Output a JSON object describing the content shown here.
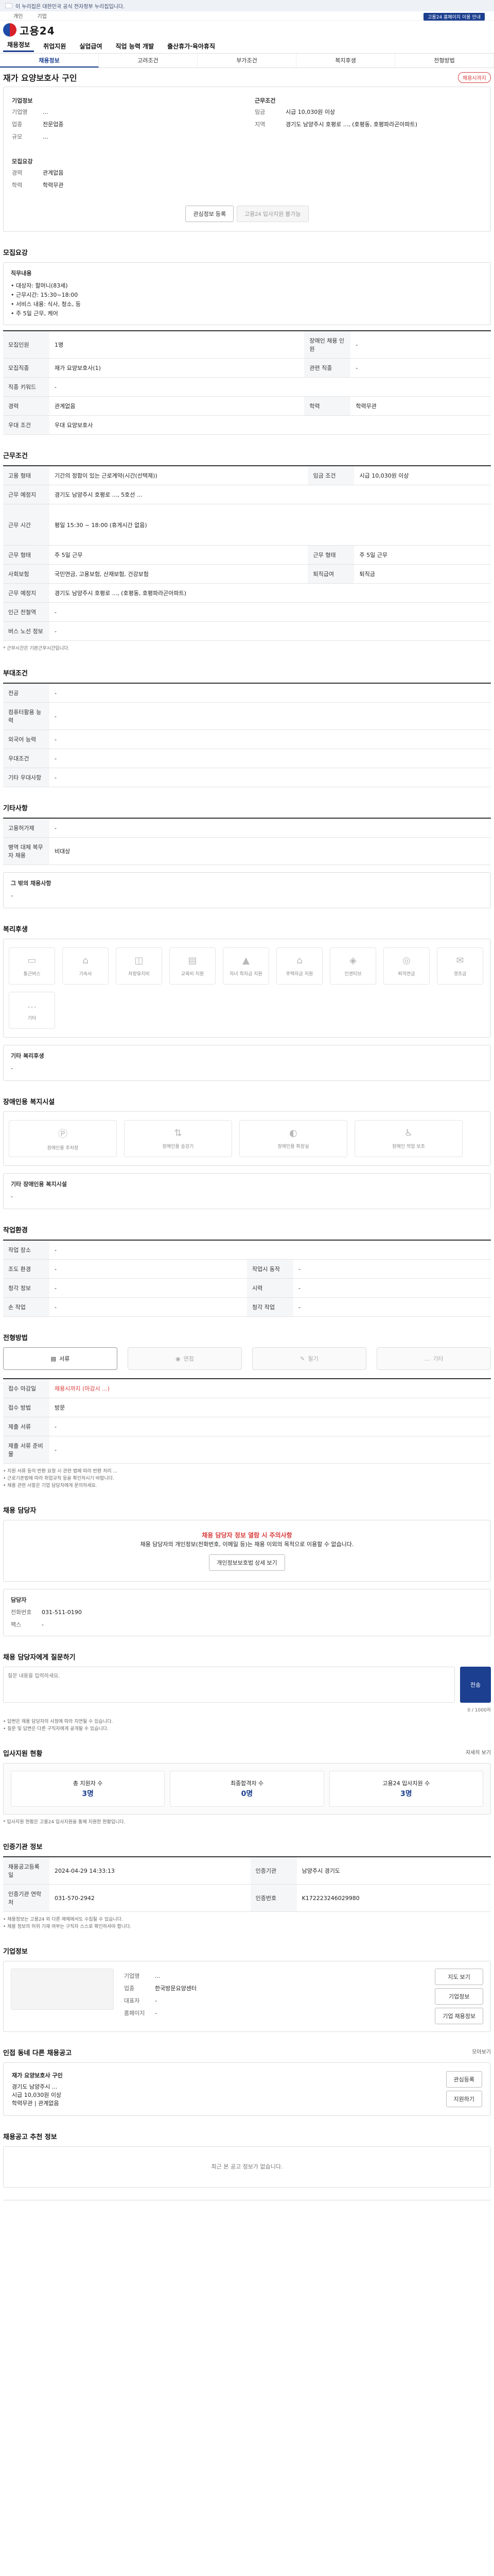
{
  "gov_banner": "이 누리집은 대한민국 공식 전자정부 누리집입니다.",
  "util": {
    "links": [
      "개인",
      "기업"
    ],
    "right": [
      "고용24 홈페이지 이용 안내"
    ]
  },
  "logo": "고용24",
  "gnb": [
    "채용정보",
    "취업지원",
    "실업급여",
    "직업 능력 개발",
    "출산휴가·육아휴직"
  ],
  "lnb": [
    "채용정보",
    "고려조건",
    "부가조건",
    "복지후생",
    "전형방법"
  ],
  "title": "재가 요양보호사 구인",
  "badge": "채용시까지",
  "company": {
    "heading": "기업정보",
    "name_label": "기업명",
    "name": "...",
    "industry_label": "업종",
    "industry": "전문업종",
    "size_label": "규모",
    "size": "...",
    "detail_heading": "모집요강",
    "detail_list": [
      {
        "k": "경력",
        "v": "관계없음"
      },
      {
        "k": "학력",
        "v": "학력무관"
      }
    ]
  },
  "job_summary": {
    "heading": "근무조건",
    "rows": [
      {
        "k": "임금",
        "v": "시급 10,030원 이상"
      },
      {
        "k": "지역",
        "v": "경기도 남양주시 호평로 ..., (호평동, 호평파라곤아파트)"
      }
    ]
  },
  "buttons": {
    "favorite": "관심정보 등록",
    "apply": "고용24 입사지원 불가능"
  },
  "recruit": {
    "heading": "모집요강",
    "duty_label": "직무내용",
    "duties": [
      "• 대상자: 할머니(83세)",
      "• 근무시간: 15:30~18:00",
      "• 서비스 내용: 식사, 청소, 등",
      "• 주 5일 근무, 케어"
    ],
    "rows": [
      {
        "k": "모집인원",
        "v": "1명",
        "k2": "장애인 채용 인원",
        "v2": "-"
      },
      {
        "k": "모집직종",
        "v": "재가 요양보호사(1)",
        "k2": "관련 직종",
        "v2": "-"
      },
      {
        "k": "직종 키워드",
        "v": "-",
        "k2": "",
        "v2": ""
      },
      {
        "k": "경력",
        "v": "관계없음",
        "k2": "학력",
        "v2": "학력무관"
      },
      {
        "k": "우대 조건",
        "v": "우대 요양보호사",
        "k2": "",
        "v2": ""
      }
    ]
  },
  "conditions": {
    "heading": "근무조건",
    "rows": [
      {
        "k": "고용 형태",
        "v": "기간의 정함이 있는 근로계약(시간(선택제))",
        "k2": "임금 조건",
        "v2": "시급 10,030원 이상"
      },
      {
        "k": "근무 예정지",
        "v": "경기도 남양주시 호평로 ..., 5호선 ...",
        "k2": "",
        "v2": ""
      },
      {
        "k": "근무 시간",
        "v": "평일 15:30 ~ 18:00 (휴게시간 없음)",
        "k2": "",
        "v2": ""
      },
      {
        "k": "근무 형태",
        "v": "주 5일 근무",
        "k2": "근무 형태",
        "v2": "주 5일 근무"
      },
      {
        "k": "사회보험",
        "v": "국민연금, 고용보험, 산재보험, 건강보험",
        "k2": "퇴직급여",
        "v2": "퇴직금"
      },
      {
        "k": "근무 예정지",
        "v": "경기도 남양주시 호평로 ..., (호평동, 호평파라곤아파트)",
        "k2": "",
        "v2": ""
      },
      {
        "k": "인근 전철역",
        "v": "-",
        "k2": "",
        "v2": ""
      },
      {
        "k": "버스 노선 정보",
        "v": "-",
        "k2": "",
        "v2": ""
      }
    ],
    "note": "* 근무시간은 기본근무시간입니다."
  },
  "extra": {
    "heading": "부대조건",
    "rows": [
      {
        "k": "전공",
        "v": "-"
      },
      {
        "k": "컴퓨터활용 능력",
        "v": "-"
      },
      {
        "k": "외국어 능력",
        "v": "-"
      },
      {
        "k": "우대조건",
        "v": "-"
      },
      {
        "k": "기타 우대사항",
        "v": "-"
      }
    ]
  },
  "other": {
    "heading": "기타사항",
    "rows": [
      {
        "k": "고용허가제",
        "v": "-"
      },
      {
        "k": "병역 대체 복무자 채용",
        "v": "비대상"
      }
    ],
    "box_label": "그 밖의 채용사항",
    "box_value": "-"
  },
  "welfare": {
    "heading": "복리후생",
    "items": [
      "통근버스",
      "기숙사",
      "차량유지비",
      "교육비 지원",
      "자녀 학자금 지원",
      "주택자금 지원",
      "인센티브",
      "퇴직연금",
      "경조금",
      "기타"
    ],
    "other_label": "기타 복리후생",
    "other_value": "-"
  },
  "disability": {
    "heading": "장애인용 복지시설",
    "items": [
      "장애인용 주차장",
      "장애인용 승강기",
      "장애인용 화장실",
      "장애인 작업 보조"
    ],
    "other_label": "기타 장애인용 복지시설",
    "other_value": "-"
  },
  "env": {
    "heading": "작업환경",
    "rows": [
      {
        "k": "작업 장소",
        "v": "-",
        "k2": "",
        "v2": ""
      },
      {
        "k": "조도 환경",
        "v": "-",
        "k2": "작업시 동작",
        "v2": "-"
      },
      {
        "k": "청각 정보",
        "v": "-",
        "k2": "시력",
        "v2": "-"
      },
      {
        "k": "손 작업",
        "v": "-",
        "k2": "청각 작업",
        "v2": "-"
      }
    ]
  },
  "process": {
    "heading": "전형방법",
    "methods": [
      "서류",
      "면접",
      "필기",
      "기타"
    ],
    "rows": [
      {
        "k": "접수 마감일",
        "v": "채용시까지 (마감시 ...)"
      },
      {
        "k": "접수 방법",
        "v": "방문"
      },
      {
        "k": "제출 서류",
        "v": "-"
      },
      {
        "k": "제출 서류 준비물",
        "v": "-"
      }
    ],
    "notes": [
      "• 지원 서류 등의 반환 요청 시 관련 법에 따라 반환 처리 ...",
      "• 근로기준법에 따라 취업규칙 등을 확인하시기 바랍니다.",
      "• 채용 관련 사항은 기업 담당자에게 문의하세요."
    ]
  },
  "contact": {
    "heading": "채용 담당자",
    "alert_title": "채용 담당자 정보 열람 시 주의사항",
    "alert_text": "채용 담당자의 개인정보(전화번호, 이메일 등)는 채용 이외의 목적으로 이용할 수 없습니다.",
    "view_button": "개인정보보호법 상세 보기",
    "label": "담당자",
    "phone_label": "전화번호",
    "phone": "031-511-0190",
    "fax_label": "팩스",
    "fax": "-"
  },
  "inquiry": {
    "heading": "채용 담당자에게 질문하기",
    "placeholder": "질문 내용을 입력하세요.",
    "counter": "0 / 1000자",
    "send": "전송",
    "notes": [
      "• 답변은 채용 담당자의 사정에 따라 지연될 수 있습니다.",
      "• 질문 및 답변은 다른 구직자에게 공개될 수 있습니다."
    ]
  },
  "apply_status": {
    "heading": "입사지원 현황",
    "more": "자세히 보기",
    "stats": [
      {
        "label": "총 지원자 수",
        "value": "3명"
      },
      {
        "label": "최종합격자 수",
        "value": "0명"
      },
      {
        "label": "고용24 입사지원 수",
        "value": "3명"
      }
    ],
    "note": "* 입사지원 현황은 고용24 입사지원을 통해 지원한 현황입니다."
  },
  "info": {
    "heading": "인증기관 정보",
    "rows": [
      {
        "k": "채용공고등록일",
        "v": "2024-04-29 14:33:13",
        "k2": "인증기관",
        "v2": "남양주시 경기도"
      },
      {
        "k": "인증기관 연락처",
        "v": "031-570-2942",
        "k2": "인증번호",
        "v2": "K172223246029980"
      }
    ],
    "notes": [
      "• 채용정보는 고용24 외 다른 매체에서도 수집될 수 있습니다.",
      "• 채용 정보의 허위 기재 여부는 구직자 스스로 확인하셔야 합니다."
    ]
  },
  "company_info": {
    "heading": "기업정보",
    "name_label": "기업명",
    "name": "...",
    "industry_label": "업종",
    "industry": "한국방문요양센터",
    "ceo_label": "대표자",
    "ceo": "-",
    "homepage_label": "홈페이지",
    "homepage": "-",
    "map_button": "지도 보기",
    "sub_buttons": [
      "기업정보",
      "기업 채용정보"
    ]
  },
  "related": {
    "heading": "인접 동네 다른 채용공고",
    "more": "모아보기",
    "title": "재가 요양보호사 구인",
    "lines": [
      "경기도 남양주시 ...",
      "시급 10,030원 이상",
      "학력무관 | 관계없음"
    ],
    "buttons": [
      "관심등록",
      "지원하기"
    ]
  },
  "recent": {
    "heading": "채용공고 추천 정보",
    "empty": "최근 본 공고 정보가 없습니다."
  }
}
